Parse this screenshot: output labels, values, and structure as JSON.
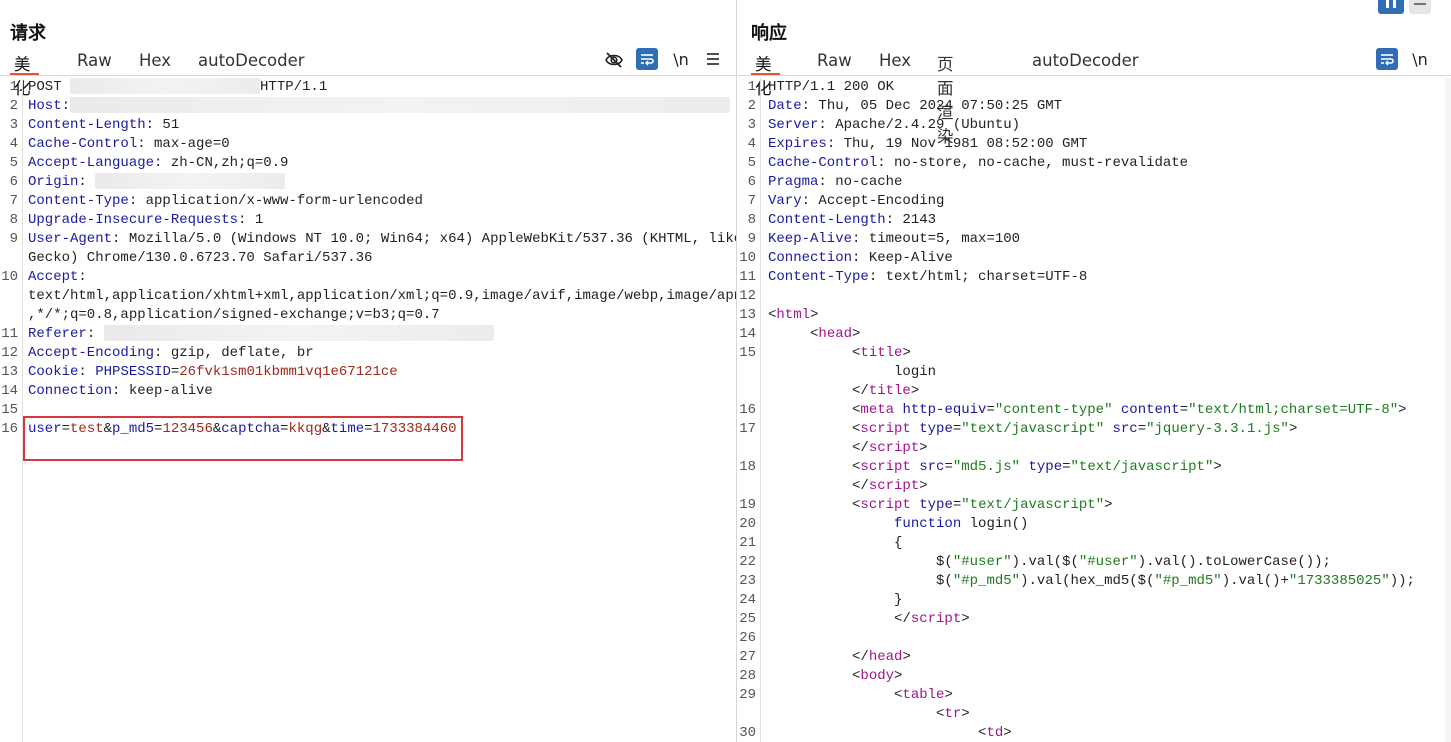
{
  "request": {
    "title": "请求",
    "tabs": [
      "美化",
      "Raw",
      "Hex",
      "autoDecoder"
    ],
    "active_tab": "美化",
    "icons": [
      "eye-off-icon",
      "wrap-icon",
      "newline-icon",
      "menu-icon"
    ],
    "newline_label": "\\n",
    "menu_label": "≡",
    "lines": [
      {
        "n": "1",
        "parts": [
          {
            "t": "POST ",
            "c": "v"
          },
          {
            "blur": 190
          },
          {
            "t": "HTTP/1.1",
            "c": "v"
          }
        ]
      },
      {
        "n": "2",
        "parts": [
          {
            "t": "Host",
            "c": "k"
          },
          {
            "t": ":",
            "c": "v"
          },
          {
            "blur": 660
          }
        ]
      },
      {
        "n": "3",
        "parts": [
          {
            "t": "Content-Length",
            "c": "k"
          },
          {
            "t": ": 51",
            "c": "v"
          }
        ]
      },
      {
        "n": "4",
        "parts": [
          {
            "t": "Cache-Control",
            "c": "k"
          },
          {
            "t": ": max-age=0",
            "c": "v"
          }
        ]
      },
      {
        "n": "5",
        "parts": [
          {
            "t": "Accept-Language",
            "c": "k"
          },
          {
            "t": ": zh-CN,zh;q=0.9",
            "c": "v"
          }
        ]
      },
      {
        "n": "6",
        "parts": [
          {
            "t": "Origin",
            "c": "k"
          },
          {
            "t": ": ",
            "c": "v"
          },
          {
            "blur": 190
          }
        ]
      },
      {
        "n": "7",
        "parts": [
          {
            "t": "Content-Type",
            "c": "k"
          },
          {
            "t": ": application/x-www-form-urlencoded",
            "c": "v"
          }
        ]
      },
      {
        "n": "8",
        "parts": [
          {
            "t": "Upgrade-Insecure-Requests",
            "c": "k"
          },
          {
            "t": ": 1",
            "c": "v"
          }
        ]
      },
      {
        "n": "9",
        "parts": [
          {
            "t": "User-Agent",
            "c": "k"
          },
          {
            "t": ": Mozilla/5.0 (Windows NT 10.0; Win64; x64) AppleWebKit/537.36 (KHTML, like",
            "c": "v"
          }
        ]
      },
      {
        "n": "",
        "parts": [
          {
            "t": "Gecko) Chrome/130.0.6723.70 Safari/537.36",
            "c": "v"
          }
        ]
      },
      {
        "n": "10",
        "parts": [
          {
            "t": "Accept",
            "c": "k"
          },
          {
            "t": ":",
            "c": "v"
          }
        ]
      },
      {
        "n": "",
        "parts": [
          {
            "t": "text/html,application/xhtml+xml,application/xml;q=0.9,image/avif,image/webp,image/apng",
            "c": "v"
          }
        ]
      },
      {
        "n": "",
        "parts": [
          {
            "t": ",*/*;q=0.8,application/signed-exchange;v=b3;q=0.7",
            "c": "v"
          }
        ]
      },
      {
        "n": "11",
        "parts": [
          {
            "t": "Referer",
            "c": "k"
          },
          {
            "t": ": ",
            "c": "v"
          },
          {
            "blur": 390
          }
        ]
      },
      {
        "n": "12",
        "parts": [
          {
            "t": "Accept-Encoding",
            "c": "k"
          },
          {
            "t": ": gzip, deflate, br",
            "c": "v"
          }
        ]
      },
      {
        "n": "13",
        "parts": [
          {
            "t": "Cookie",
            "c": "k"
          },
          {
            "t": ": ",
            "c": "v"
          },
          {
            "t": "PHPSESSID",
            "c": "blue2"
          },
          {
            "t": "=",
            "c": "v"
          },
          {
            "t": "26fvk1sm01kbmm1vq1e67121ce",
            "c": "red"
          }
        ]
      },
      {
        "n": "14",
        "parts": [
          {
            "t": "Connection",
            "c": "k"
          },
          {
            "t": ": keep-alive",
            "c": "v"
          }
        ]
      },
      {
        "n": "15",
        "parts": []
      },
      {
        "n": "16",
        "parts": [
          {
            "t": "user",
            "c": "blue2"
          },
          {
            "t": "=",
            "c": "v"
          },
          {
            "t": "test",
            "c": "red"
          },
          {
            "t": "&",
            "c": "v"
          },
          {
            "t": "p_md5",
            "c": "blue2"
          },
          {
            "t": "=",
            "c": "v"
          },
          {
            "t": "123456",
            "c": "red"
          },
          {
            "t": "&",
            "c": "v"
          },
          {
            "t": "captcha",
            "c": "blue2"
          },
          {
            "t": "=",
            "c": "v"
          },
          {
            "t": "kkqg",
            "c": "red"
          },
          {
            "t": "&",
            "c": "v"
          },
          {
            "t": "time",
            "c": "blue2"
          },
          {
            "t": "=",
            "c": "v"
          },
          {
            "t": "1733384460",
            "c": "red"
          }
        ]
      }
    ]
  },
  "response": {
    "title": "响应",
    "tabs": [
      "美化",
      "Raw",
      "Hex",
      "页面渲染",
      "autoDecoder"
    ],
    "active_tab": "美化",
    "icons": [
      "wrap-icon",
      "newline-icon",
      "menu-icon"
    ],
    "newline_label": "\\n",
    "lines": [
      {
        "n": "1",
        "parts": [
          {
            "t": "HTTP/1.1 200 OK",
            "c": "v"
          }
        ]
      },
      {
        "n": "2",
        "parts": [
          {
            "t": "Date",
            "c": "k"
          },
          {
            "t": ": Thu, 05 Dec 2024 07:50:25 GMT",
            "c": "v"
          }
        ]
      },
      {
        "n": "3",
        "parts": [
          {
            "t": "Server",
            "c": "k"
          },
          {
            "t": ": Apache/2.4.29 (Ubuntu)",
            "c": "v"
          }
        ]
      },
      {
        "n": "4",
        "parts": [
          {
            "t": "Expires",
            "c": "k"
          },
          {
            "t": ": Thu, 19 Nov 1981 08:52:00 GMT",
            "c": "v"
          }
        ]
      },
      {
        "n": "5",
        "parts": [
          {
            "t": "Cache-Control",
            "c": "k"
          },
          {
            "t": ": no-store, no-cache, must-revalidate",
            "c": "v"
          }
        ]
      },
      {
        "n": "6",
        "parts": [
          {
            "t": "Pragma",
            "c": "k"
          },
          {
            "t": ": no-cache",
            "c": "v"
          }
        ]
      },
      {
        "n": "7",
        "parts": [
          {
            "t": "Vary",
            "c": "k"
          },
          {
            "t": ": Accept-Encoding",
            "c": "v"
          }
        ]
      },
      {
        "n": "8",
        "parts": [
          {
            "t": "Content-Length",
            "c": "k"
          },
          {
            "t": ": 2143",
            "c": "v"
          }
        ]
      },
      {
        "n": "9",
        "parts": [
          {
            "t": "Keep-Alive",
            "c": "k"
          },
          {
            "t": ": timeout=5, max=100",
            "c": "v"
          }
        ]
      },
      {
        "n": "10",
        "parts": [
          {
            "t": "Connection",
            "c": "k"
          },
          {
            "t": ": Keep-Alive",
            "c": "v"
          }
        ]
      },
      {
        "n": "11",
        "parts": [
          {
            "t": "Content-Type",
            "c": "k"
          },
          {
            "t": ": text/html; charset=UTF-8",
            "c": "v"
          }
        ]
      },
      {
        "n": "12",
        "parts": []
      },
      {
        "n": "13",
        "parts": [
          {
            "t": "<",
            "c": "v"
          },
          {
            "t": "html",
            "c": "tag"
          },
          {
            "t": ">",
            "c": "v"
          }
        ]
      },
      {
        "n": "14",
        "parts": [
          {
            "t": "     <",
            "c": "v"
          },
          {
            "t": "head",
            "c": "tag"
          },
          {
            "t": ">",
            "c": "v"
          }
        ]
      },
      {
        "n": "15",
        "parts": [
          {
            "t": "          <",
            "c": "v"
          },
          {
            "t": "title",
            "c": "tag"
          },
          {
            "t": ">",
            "c": "v"
          }
        ]
      },
      {
        "n": "",
        "parts": [
          {
            "t": "               login",
            "c": "v"
          }
        ]
      },
      {
        "n": "",
        "parts": [
          {
            "t": "          </",
            "c": "v"
          },
          {
            "t": "title",
            "c": "tag"
          },
          {
            "t": ">",
            "c": "v"
          }
        ]
      },
      {
        "n": "16",
        "parts": [
          {
            "t": "          <",
            "c": "v"
          },
          {
            "t": "meta",
            "c": "tag"
          },
          {
            "t": " ",
            "c": "v"
          },
          {
            "t": "http-equiv",
            "c": "attr"
          },
          {
            "t": "=",
            "c": "v"
          },
          {
            "t": "\"content-type\"",
            "c": "str"
          },
          {
            "t": " ",
            "c": "v"
          },
          {
            "t": "content",
            "c": "attr"
          },
          {
            "t": "=",
            "c": "v"
          },
          {
            "t": "\"text/html;charset=UTF-8\"",
            "c": "str"
          },
          {
            "t": ">",
            "c": "v"
          }
        ]
      },
      {
        "n": "17",
        "parts": [
          {
            "t": "          <",
            "c": "v"
          },
          {
            "t": "script",
            "c": "tag"
          },
          {
            "t": " ",
            "c": "v"
          },
          {
            "t": "type",
            "c": "attr"
          },
          {
            "t": "=",
            "c": "v"
          },
          {
            "t": "\"text/javascript\"",
            "c": "str"
          },
          {
            "t": " ",
            "c": "v"
          },
          {
            "t": "src",
            "c": "attr"
          },
          {
            "t": "=",
            "c": "v"
          },
          {
            "t": "\"jquery-3.3.1.js\"",
            "c": "str"
          },
          {
            "t": ">",
            "c": "v"
          }
        ]
      },
      {
        "n": "",
        "parts": [
          {
            "t": "          </",
            "c": "v"
          },
          {
            "t": "script",
            "c": "tag"
          },
          {
            "t": ">",
            "c": "v"
          }
        ]
      },
      {
        "n": "18",
        "parts": [
          {
            "t": "          <",
            "c": "v"
          },
          {
            "t": "script",
            "c": "tag"
          },
          {
            "t": " ",
            "c": "v"
          },
          {
            "t": "src",
            "c": "attr"
          },
          {
            "t": "=",
            "c": "v"
          },
          {
            "t": "\"md5.js\"",
            "c": "str"
          },
          {
            "t": " ",
            "c": "v"
          },
          {
            "t": "type",
            "c": "attr"
          },
          {
            "t": "=",
            "c": "v"
          },
          {
            "t": "\"text/javascript\"",
            "c": "str"
          },
          {
            "t": ">",
            "c": "v"
          }
        ]
      },
      {
        "n": "",
        "parts": [
          {
            "t": "          </",
            "c": "v"
          },
          {
            "t": "script",
            "c": "tag"
          },
          {
            "t": ">",
            "c": "v"
          }
        ]
      },
      {
        "n": "19",
        "parts": [
          {
            "t": "          <",
            "c": "v"
          },
          {
            "t": "script",
            "c": "tag"
          },
          {
            "t": " ",
            "c": "v"
          },
          {
            "t": "type",
            "c": "attr"
          },
          {
            "t": "=",
            "c": "v"
          },
          {
            "t": "\"text/javascript\"",
            "c": "str"
          },
          {
            "t": ">",
            "c": "v"
          }
        ]
      },
      {
        "n": "20",
        "parts": [
          {
            "t": "               function",
            "c": "k"
          },
          {
            "t": " login()",
            "c": "v"
          }
        ]
      },
      {
        "n": "21",
        "parts": [
          {
            "t": "               {",
            "c": "v"
          }
        ]
      },
      {
        "n": "22",
        "parts": [
          {
            "t": "                    $(",
            "c": "v"
          },
          {
            "t": "\"#user\"",
            "c": "str"
          },
          {
            "t": ").val($(",
            "c": "v"
          },
          {
            "t": "\"#user\"",
            "c": "str"
          },
          {
            "t": ").val().toLowerCase());",
            "c": "v"
          }
        ]
      },
      {
        "n": "23",
        "parts": [
          {
            "t": "                    $(",
            "c": "v"
          },
          {
            "t": "\"#p_md5\"",
            "c": "str"
          },
          {
            "t": ").val(hex_md5($(",
            "c": "v"
          },
          {
            "t": "\"#p_md5\"",
            "c": "str"
          },
          {
            "t": ").val()+",
            "c": "v"
          },
          {
            "t": "\"1733385025\"",
            "c": "str"
          },
          {
            "t": "));",
            "c": "v"
          }
        ]
      },
      {
        "n": "24",
        "parts": [
          {
            "t": "               }",
            "c": "v"
          }
        ]
      },
      {
        "n": "25",
        "parts": [
          {
            "t": "               </",
            "c": "v"
          },
          {
            "t": "script",
            "c": "tag"
          },
          {
            "t": ">",
            "c": "v"
          }
        ]
      },
      {
        "n": "26",
        "parts": []
      },
      {
        "n": "27",
        "parts": [
          {
            "t": "          </",
            "c": "v"
          },
          {
            "t": "head",
            "c": "tag"
          },
          {
            "t": ">",
            "c": "v"
          }
        ]
      },
      {
        "n": "28",
        "parts": [
          {
            "t": "          <",
            "c": "v"
          },
          {
            "t": "body",
            "c": "tag"
          },
          {
            "t": ">",
            "c": "v"
          }
        ]
      },
      {
        "n": "29",
        "parts": [
          {
            "t": "               <",
            "c": "v"
          },
          {
            "t": "table",
            "c": "tag"
          },
          {
            "t": ">",
            "c": "v"
          }
        ]
      },
      {
        "n": "",
        "parts": [
          {
            "t": "                    <",
            "c": "v"
          },
          {
            "t": "tr",
            "c": "tag"
          },
          {
            "t": ">",
            "c": "v"
          }
        ]
      },
      {
        "n": "30",
        "parts": [
          {
            "t": "                         <",
            "c": "v"
          },
          {
            "t": "td",
            "c": "tag"
          },
          {
            "t": ">",
            "c": "v"
          }
        ]
      }
    ]
  },
  "colors": {
    "accent_underline": "#e4572e",
    "icon_blue": "#2f6eb5",
    "highlight_red": "#d9363e",
    "header_key": "#1a1a9e",
    "param_value": "#a0291a",
    "html_tag": "#a0148c",
    "string": "#1f7a1f"
  }
}
